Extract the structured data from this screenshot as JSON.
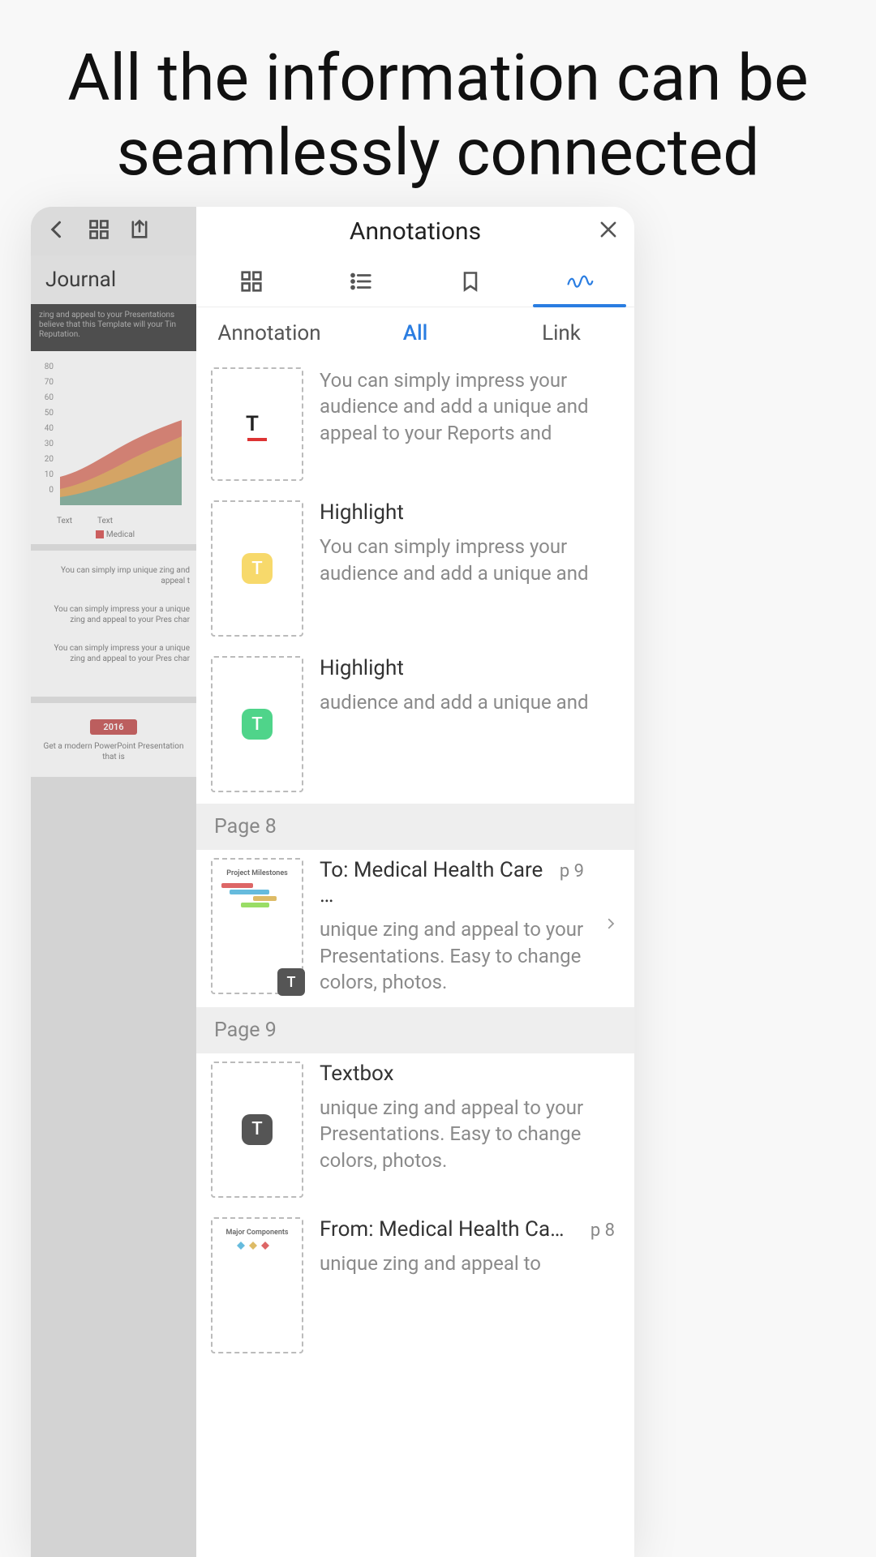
{
  "headline": "All the information can be seamlessly connected",
  "left": {
    "journal_label": "Journal",
    "dark_slide_text": "zing and appeal to your Presentations believe that this Template will your Tin Reputation.",
    "chart": {
      "y_ticks": [
        "80",
        "70",
        "60",
        "50",
        "40",
        "30",
        "20",
        "10",
        "0"
      ],
      "x_labels": [
        "Text",
        "Text"
      ],
      "legend": "Medical"
    },
    "paras": [
      "You can simply imp unique zing and appeal t",
      "You can simply impress your a unique zing and appeal to your Pres char",
      "You can simply impress your a unique zing and appeal to your Pres char"
    ],
    "year_badge": "2016",
    "year_sub": "Get a modern PowerPoint Presentation that is"
  },
  "panel": {
    "title": "Annotations",
    "filter_tabs": {
      "annotation": "Annotation",
      "all": "All",
      "link": "Link"
    },
    "rows": [
      {
        "title": "",
        "text": "You can simply impress your audience and add a unique and appeal to your Reports and",
        "thumb": "underline"
      },
      {
        "title": "Highlight",
        "text": "You can simply impress your audience and add a unique and",
        "thumb": "yellow"
      },
      {
        "title": "Highlight",
        "text": "audience and add a unique and",
        "thumb": "green"
      }
    ],
    "page8_label": "Page 8",
    "page8_row": {
      "title": "To: Medical Health Care …",
      "page": "p 9",
      "text": "unique zing and appeal to your Presentations. Easy to change colors, photos.",
      "thumb_title": "Project Milestones"
    },
    "page9_label": "Page 9",
    "page9_rows": [
      {
        "title": "Textbox",
        "text": "unique zing and appeal to your Presentations. Easy to  change colors, photos.",
        "thumb": "dark"
      },
      {
        "title": "From: Medical Health Ca…",
        "page": "p 8",
        "text": "unique zing and appeal to",
        "thumb_title": "Major Components"
      }
    ]
  }
}
